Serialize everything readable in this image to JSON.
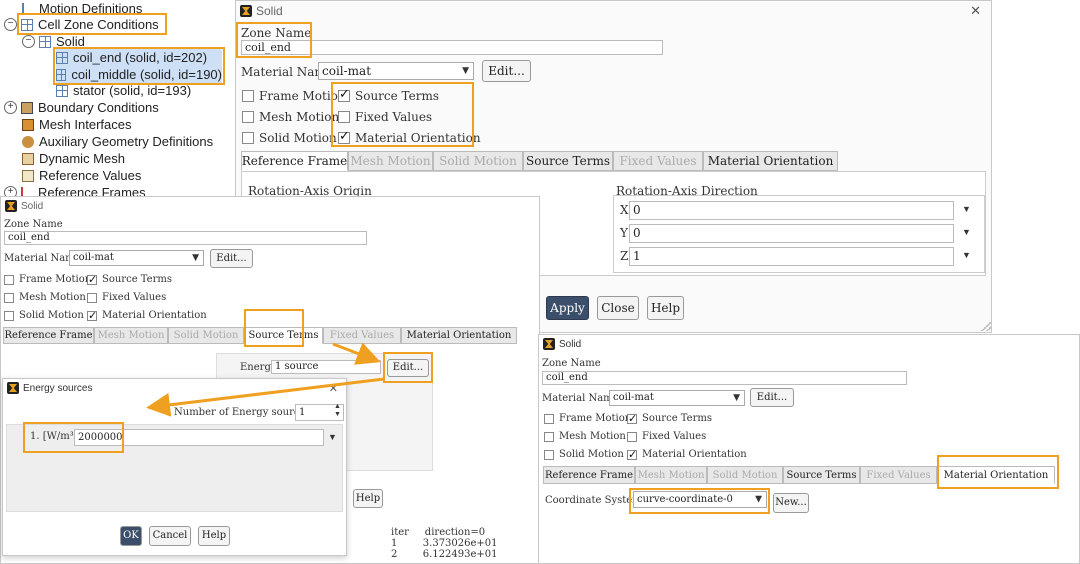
{
  "tree": {
    "items": [
      {
        "label": "Motion Definitions"
      },
      {
        "label": "Cell Zone Conditions"
      },
      {
        "label": "Solid"
      },
      {
        "label": "coil_end (solid, id=202)"
      },
      {
        "label": "coil_middle (solid, id=190)"
      },
      {
        "label": "stator (solid, id=193)"
      },
      {
        "label": "Boundary Conditions"
      },
      {
        "label": "Mesh Interfaces"
      },
      {
        "label": "Auxiliary Geometry Definitions"
      },
      {
        "label": "Dynamic Mesh"
      },
      {
        "label": "Reference Values"
      },
      {
        "label": "Reference Frames"
      }
    ]
  },
  "dialog1": {
    "title": "Solid",
    "close": "✕",
    "zone_name_label": "Zone Name",
    "zone_name_value": "coil_end",
    "material_label": "Material Name",
    "material_value": "coil-mat",
    "edit": "Edit...",
    "checks": {
      "frame_motion": "Frame Motion",
      "source_terms": "Source Terms",
      "mesh_motion": "Mesh Motion",
      "fixed_values": "Fixed Values",
      "solid_motion": "Solid Motion",
      "material_orientation": "Material Orientation"
    },
    "tabs": [
      "Reference Frame",
      "Mesh Motion",
      "Solid Motion",
      "Source Terms",
      "Fixed Values",
      "Material Orientation"
    ],
    "origin_label": "Rotation-Axis Origin",
    "direction_label": "Rotation-Axis Direction",
    "axes": [
      "X",
      "Y",
      "Z"
    ],
    "dir_values": [
      "0",
      "0",
      "1"
    ],
    "apply": "Apply",
    "close_btn": "Close",
    "help": "Help"
  },
  "dialog2": {
    "title": "Solid",
    "zone_name_label": "Zone Name",
    "zone_name_value": "coil_end",
    "material_label": "Material Name",
    "material_value": "coil-mat",
    "edit": "Edit...",
    "checks": {
      "frame_motion": "Frame Motion",
      "source_terms": "Source Terms",
      "mesh_motion": "Mesh Motion",
      "fixed_values": "Fixed Values",
      "solid_motion": "Solid Motion",
      "material_orientation": "Material Orientation"
    },
    "tabs": [
      "Reference Frame",
      "Mesh Motion",
      "Solid Motion",
      "Source Terms",
      "Fixed Values",
      "Material Orientation"
    ],
    "energy_label": "Energy",
    "energy_value": "1 source",
    "energy_edit": "Edit...",
    "help": "Help"
  },
  "dialog3": {
    "title": "Energy sources",
    "close": "✕",
    "num_label": "Number of Energy sources",
    "num_value": "1",
    "row_label": "1. [W/m³]",
    "row_value": "2000000",
    "ok": "OK",
    "cancel": "Cancel",
    "help": "Help"
  },
  "dialog4": {
    "title": "Solid",
    "zone_name_label": "Zone Name",
    "zone_name_value": "coil_end",
    "material_label": "Material Name",
    "material_value": "coil-mat",
    "edit": "Edit...",
    "checks": {
      "frame_motion": "Frame Motion",
      "source_terms": "Source Terms",
      "mesh_motion": "Mesh Motion",
      "fixed_values": "Fixed Values",
      "solid_motion": "Solid Motion",
      "material_orientation": "Material Orientation"
    },
    "tabs": [
      "Reference Frame",
      "Mesh Motion",
      "Solid Motion",
      "Source Terms",
      "Fixed Values",
      "Material Orientation"
    ],
    "coord_label": "Coordinate System",
    "coord_value": "curve-coordinate-0",
    "new_btn": "New..."
  },
  "console": {
    "header": "iter     direction=0",
    "rows": [
      "1        3.373026e+01",
      "2        6.122493e+01"
    ]
  },
  "colors": {
    "highlight": "#f0a020",
    "selection": "#cde0f5",
    "apply_bg": "#3b4f6b"
  }
}
